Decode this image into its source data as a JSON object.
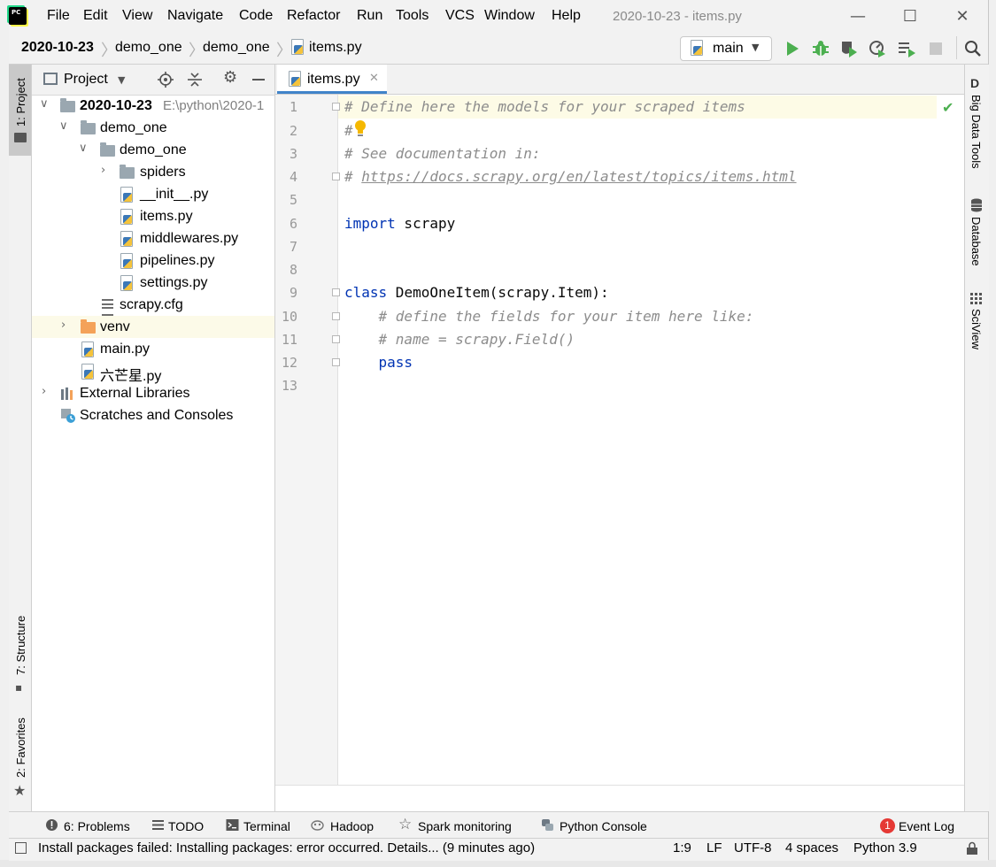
{
  "window": {
    "title": "2020-10-23 - items.py",
    "menu": [
      "File",
      "Edit",
      "View",
      "Navigate",
      "Code",
      "Refactor",
      "Run",
      "Tools",
      "VCS",
      "Window",
      "Help"
    ],
    "controls": {
      "minimize": "—",
      "maximize": "☐",
      "close": "✕"
    }
  },
  "breadcrumbs": [
    "2020-10-23",
    "demo_one",
    "demo_one",
    "items.py"
  ],
  "toolbar": {
    "run_config": "main",
    "icons": [
      "run-icon",
      "debug-icon",
      "coverage-icon",
      "profile-icon",
      "build-icon",
      "stop-icon",
      "search-icon"
    ]
  },
  "left_strip": {
    "project_tab": "1: Project",
    "structure_tab": "7: Structure",
    "favorites_tab": "2: Favorites"
  },
  "right_strip": {
    "big_data_tools": "Big Data Tools",
    "database": "Database",
    "sciview": "SciView"
  },
  "project_panel": {
    "title": "Project",
    "tree": [
      {
        "label": "2020-10-23",
        "path": "E:\\python\\2020-1",
        "type": "folder",
        "expanded": true
      },
      {
        "label": "demo_one",
        "type": "folder",
        "expanded": true
      },
      {
        "label": "demo_one",
        "type": "folder",
        "expanded": true
      },
      {
        "label": "spiders",
        "type": "folder",
        "expanded": false
      },
      {
        "label": "__init__.py",
        "type": "python"
      },
      {
        "label": "items.py",
        "type": "python"
      },
      {
        "label": "middlewares.py",
        "type": "python"
      },
      {
        "label": "pipelines.py",
        "type": "python"
      },
      {
        "label": "settings.py",
        "type": "python"
      },
      {
        "label": "scrapy.cfg",
        "type": "config"
      },
      {
        "label": "venv",
        "type": "folder-excluded",
        "expanded": false,
        "selected": true
      },
      {
        "label": "main.py",
        "type": "python"
      },
      {
        "label": "六芒星.py",
        "type": "python"
      },
      {
        "label": "External Libraries",
        "type": "libraries",
        "expanded": false
      },
      {
        "label": "Scratches and Consoles",
        "type": "scratches"
      }
    ]
  },
  "editor": {
    "tab_label": "items.py",
    "lines": [
      "1",
      "2",
      "3",
      "4",
      "5",
      "6",
      "7",
      "8",
      "9",
      "10",
      "11",
      "12",
      "13"
    ],
    "code": {
      "l1": "# Define here the models for your scraped items",
      "l2": "#",
      "l3": "# See documentation in:",
      "l4_prefix": "# ",
      "l4_link": "https://docs.scrapy.org/en/latest/topics/items.html",
      "l6_kw": "import",
      "l6_rest": " scrapy",
      "l9_kw": "class",
      "l9_rest": " DemoOneItem(scrapy.Item):",
      "l10": "    # define the fields for your item here like:",
      "l11": "    # name = scrapy.Field()",
      "l12": "    pass"
    }
  },
  "tool_windows": [
    {
      "label": "6: Problems",
      "icon": "problems-icon"
    },
    {
      "label": "TODO",
      "icon": "todo-icon"
    },
    {
      "label": "Terminal",
      "icon": "terminal-icon"
    },
    {
      "label": "Hadoop",
      "icon": "hadoop-icon"
    },
    {
      "label": "Spark monitoring",
      "icon": "spark-icon"
    },
    {
      "label": "Python Console",
      "icon": "python-console-icon"
    },
    {
      "label": "Event Log",
      "icon": "event-log-icon",
      "badge": "1"
    }
  ],
  "status_bar": {
    "message": "Install packages failed: Installing packages: error occurred. Details... (9 minutes ago)",
    "position": "1:9",
    "line_separator": "LF",
    "encoding": "UTF-8",
    "indent": "4 spaces",
    "interpreter": "Python 3.9"
  },
  "colors": {
    "accent": "#4083c9",
    "keyword": "#0033b3",
    "comment": "#8c8c8c",
    "run_green": "#4caf50",
    "selection": "#fcfae8",
    "error_badge": "#e53935"
  }
}
